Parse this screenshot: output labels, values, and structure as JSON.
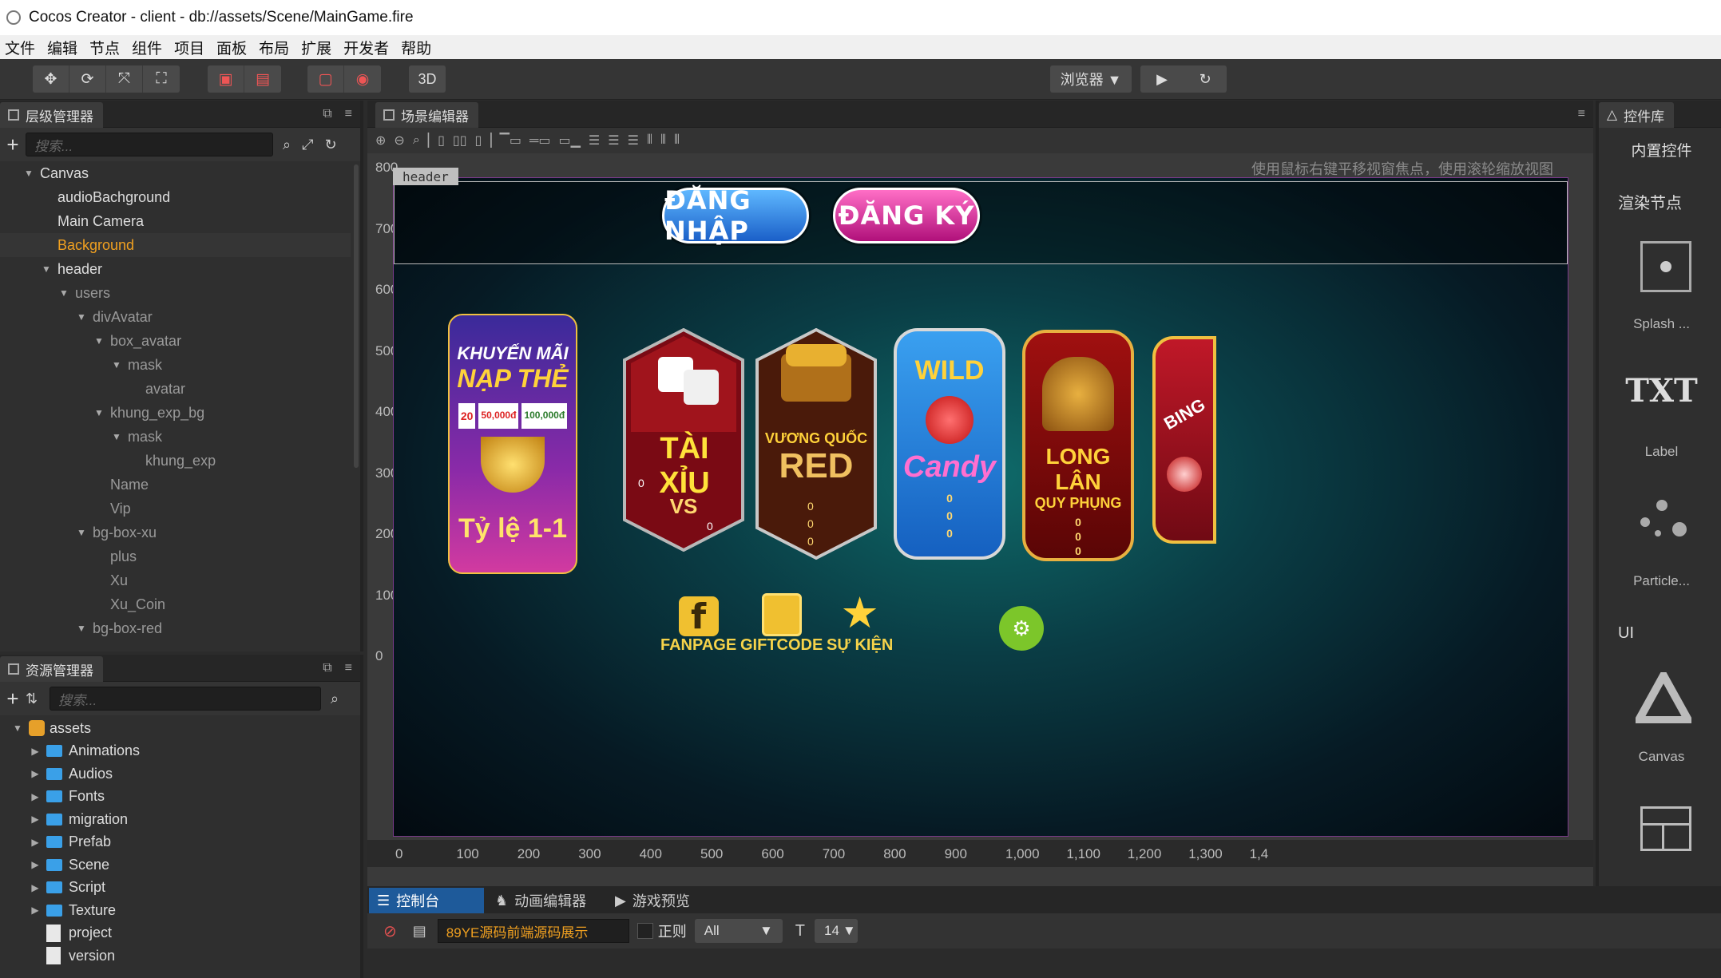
{
  "window": {
    "title": "Cocos Creator - client - db://assets/Scene/MainGame.fire"
  },
  "menu": [
    "文件",
    "编辑",
    "节点",
    "组件",
    "项目",
    "面板",
    "布局",
    "扩展",
    "开发者",
    "帮助"
  ],
  "toolbar": {
    "mode_3d": "3D",
    "browser": "浏览器 ▼",
    "play": "▶",
    "refresh": "↻"
  },
  "hierarchy": {
    "tab": "层级管理器",
    "search_placeholder": "搜索...",
    "nodes": [
      {
        "label": "Canvas",
        "depth": 0,
        "arrow": "▼",
        "state": "normal"
      },
      {
        "label": "audioBachground",
        "depth": 1,
        "arrow": "",
        "state": "normal"
      },
      {
        "label": "Main Camera",
        "depth": 1,
        "arrow": "",
        "state": "normal"
      },
      {
        "label": "Background",
        "depth": 1,
        "arrow": "",
        "state": "selected"
      },
      {
        "label": "header",
        "depth": 1,
        "arrow": "▼",
        "state": "normal"
      },
      {
        "label": "users",
        "depth": 2,
        "arrow": "▼",
        "state": "dim"
      },
      {
        "label": "divAvatar",
        "depth": 3,
        "arrow": "▼",
        "state": "dim"
      },
      {
        "label": "box_avatar",
        "depth": 4,
        "arrow": "▼",
        "state": "dim"
      },
      {
        "label": "mask",
        "depth": 5,
        "arrow": "▼",
        "state": "dim"
      },
      {
        "label": "avatar",
        "depth": 6,
        "arrow": "",
        "state": "dim"
      },
      {
        "label": "khung_exp_bg",
        "depth": 4,
        "arrow": "▼",
        "state": "dim"
      },
      {
        "label": "mask",
        "depth": 5,
        "arrow": "▼",
        "state": "dim"
      },
      {
        "label": "khung_exp",
        "depth": 6,
        "arrow": "",
        "state": "dim"
      },
      {
        "label": "Name",
        "depth": 4,
        "arrow": "",
        "state": "dim"
      },
      {
        "label": "Vip",
        "depth": 4,
        "arrow": "",
        "state": "dim"
      },
      {
        "label": "bg-box-xu",
        "depth": 3,
        "arrow": "▼",
        "state": "dim"
      },
      {
        "label": "plus",
        "depth": 4,
        "arrow": "",
        "state": "dim"
      },
      {
        "label": "Xu",
        "depth": 4,
        "arrow": "",
        "state": "dim"
      },
      {
        "label": "Xu_Coin",
        "depth": 4,
        "arrow": "",
        "state": "dim"
      },
      {
        "label": "bg-box-red",
        "depth": 3,
        "arrow": "▼",
        "state": "dim"
      }
    ]
  },
  "assets": {
    "tab": "资源管理器",
    "search_placeholder": "搜索...",
    "root": "assets",
    "folders": [
      "Animations",
      "Audios",
      "Fonts",
      "migration",
      "Prefab",
      "Scene",
      "Script",
      "Texture"
    ],
    "files": [
      "project",
      "version"
    ]
  },
  "scene": {
    "tab": "场景编辑器",
    "hint": "使用鼠标右键平移视窗焦点，使用滚轮缩放视图",
    "node_label": "header",
    "y_ticks": [
      "800",
      "700",
      "600",
      "500",
      "400",
      "300",
      "200",
      "100",
      "0"
    ],
    "x_ticks": [
      "0",
      "100",
      "200",
      "300",
      "400",
      "500",
      "600",
      "700",
      "800",
      "900",
      "1,000",
      "1,100",
      "1,200",
      "1,300",
      "1,4"
    ],
    "game": {
      "login": "ĐĂNG NHẬP",
      "register": "ĐĂNG KÝ",
      "promo_top1": "KHUYẾN MÃI",
      "promo_top2": "NẠP THẺ",
      "promo_amt1": "20",
      "promo_amt2": "50,000đ",
      "promo_amt3": "100,000đ",
      "promo_bottom": "Tỷ lệ 1-1",
      "taixiu": "TÀI XỈU",
      "vs": "VS",
      "zero": "0",
      "vuong1": "VƯƠNG QUỐC",
      "vuong2": "RED",
      "wild": "WILD",
      "candy": "Candy",
      "long1": "LONG LÂN",
      "long2": "QUY PHỤNG",
      "bingo": "BING",
      "fanpage": "FANPAGE",
      "giftcode": "GIFTCODE",
      "sukien": "SỰ KIỆN"
    }
  },
  "widgets": {
    "tab": "控件库",
    "builtin": "内置控件",
    "section_render": "渲染节点",
    "items": [
      "Splash ...",
      "Label",
      "Particle...",
      "Canvas"
    ],
    "txt": "TXT",
    "section_ui": "UI"
  },
  "console": {
    "tabs": [
      "控制台",
      "动画编辑器",
      "游戏预览"
    ],
    "filter_value": "89YE源码前端源码展示",
    "regex_label": "正则",
    "level": "All",
    "font_size": "14"
  },
  "colors": {
    "accent": "#f0a020",
    "selected_tab": "#1e5a9a",
    "folder": "#3aa0e8"
  }
}
